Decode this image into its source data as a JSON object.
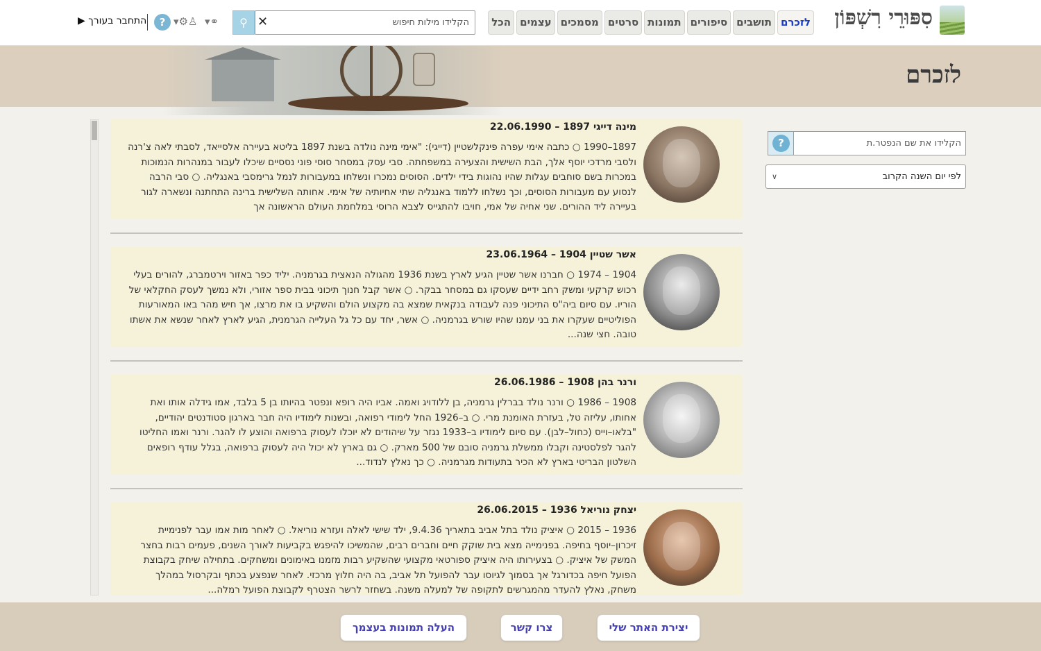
{
  "header": {
    "site_title": "סִפּוּרֵי רִשְׁפּוֹן",
    "nav": [
      "לזכרם",
      "תושבים",
      "סיפורים",
      "תמונות",
      "סרטים",
      "מסמכים",
      "עצמים",
      "הכל"
    ],
    "search_placeholder": "הקלידו מילות חיפוש",
    "login_label": "התחבר בעורך",
    "help": "?"
  },
  "banner": {
    "page_title": "לזכרם"
  },
  "filters": {
    "name_placeholder": "הקלידו את שם הנפטר.ת",
    "sort_selected": "לפי יום השנה הקרוב"
  },
  "cards": [
    {
      "name": "מינה דייגי 1897 – 22.06.1990",
      "bio": "1897–1990 ○ כתבה אימי עפרה פינקלשטיין (דייגי): \"אימי מינה נולדה בשנת 1897 בליטא בעיירה אלסייאד, לסבתי לאה צ'רנה ולסבי מרדכי יוסף אלך, הבת השישית והצעירה במשפחתה. סבי עסק במסחר סוסי פוני נססיים שיכלו לעבור במנהרות הנמוכות במכרות בשם סוחבים עגלות שהיו נהוגות בידי ילדים. הסוסים נמכרו ונשלחו במעבורות לנמל גרימסבי באנגליה. ○ סבי הרבה לנסוע עם מעבורות הסוסים, וכך נשלחו ללמוד באנגליה שתי אחיותיה של אימי. אחותה השלישית ברינה התחתנה ונשארה לגור בעיירה ליד ההורים. שני אחיה של אמי, חויבו להתגייס לצבא הרוסי במלחמת העולם הראשונה אך"
    },
    {
      "name": "אשר שטיין 1904 – 23.06.1964",
      "bio": "1904 – 1974 ○ חברנו אשר שטיין הגיע לארץ בשנת 1936 מהגולה הנאצית בגרמניה. יליד כפר באזור וירטמברג, להורים בעלי רכוש קרקעי ומשק רחב ידיים שעסקו גם במסחר בבקר. ○ אשר קבל חנוך תיכוני בבית ספר אזורי, ולא נמשך לעסק החקלאי של הוריו. עם סיום ביה\"ס התיכוני פנה לעבודה בנקאית שמצא בה מקצוע הולם והשקיע בו את מרצו, אך חיש מהר באו המאורעות הפוליטיים שעקרו את בני עמנו שהיו שורש בגרמניה. ○ אשר, יחד עם כל גל העלייה הגרמנית, הגיע לארץ לאחר שנשא את אשתו טובה. חצי שנה..."
    },
    {
      "name": "ורנר בהן 1908 – 26.06.1986",
      "bio": "1908 – 1986 ○ ורנר נולד בברלין גרמניה, בן ללודויג ואמה. אביו היה רופא ונפטר בהיותו בן 5 בלבד, אמו גידלה אותו ואת אחותו, עליזה טל, בעזרת האומנת מרי. ○ ב–1926 החל לימודי רפואה, ובשנות לימודיו היה חבר בארגון סטודנטים יהודיים, \"בלאו–וייס (כחול–לבן). עם סיום לימודיו ב–1933 נגזר על שיהודים לא יוכלו לעסוק ברפואה והוצע לו להגר. ורנר ואמו החליטו להגר לפלסטינה וקבלו ממשלת גרמניה סובם של 500 מארק. ○ גם בארץ לא יכול היה לעסוק ברפואה, בגלל עודף רופאים השלטון הבריטי בארץ לא הכיר בתעודות מגרמניה. ○ כך נאלץ לנדוד..."
    },
    {
      "name": "יצחק נוריאל 1936 – 26.06.2015",
      "bio": "1936 – 2015 ○ איציק נולד בתל אביב בתאריך 9.4.36, ילד שישי לאלה ועזרא נוריאל. ○ לאחר מות אמו עבר לפנימיית זיכרון–יוסף בחיפה. בפנימייה מצא בית שוקק חיים וחברים רבים, שהמשיכו להיפגש בקביעות לאורך השנים, פעמים רבות בחצר המשק של איציק. ○ בצעירותו היה איציק ספורטאי מקצועי שהשקיע רבות מזמנו באימונים ומשחקים. בתחילה שיחק בקבוצת הפועל חיפה בכדורגל אך בסמוך לגיוסו עבר להפועל תל אביב, בה היה חלוץ מרכזי. לאחר שנפצע בכתף ובקרסול במהלך משחק, נאלץ להעדר מהמגרשים לתקופה של למעלה משנה. בשחזר לרשר הצטרף לקבוצת הפועל רמלה..."
    }
  ],
  "footer": {
    "buttons": [
      "יצירת האתר שלי",
      "צרו קשר",
      "העלה תמונות בעצמך"
    ]
  },
  "colors": {
    "banner": "#dccfbd",
    "card": "#f6f2da",
    "nav_active_text": "#1a3cc8",
    "footer_button_text": "#4640b5"
  }
}
